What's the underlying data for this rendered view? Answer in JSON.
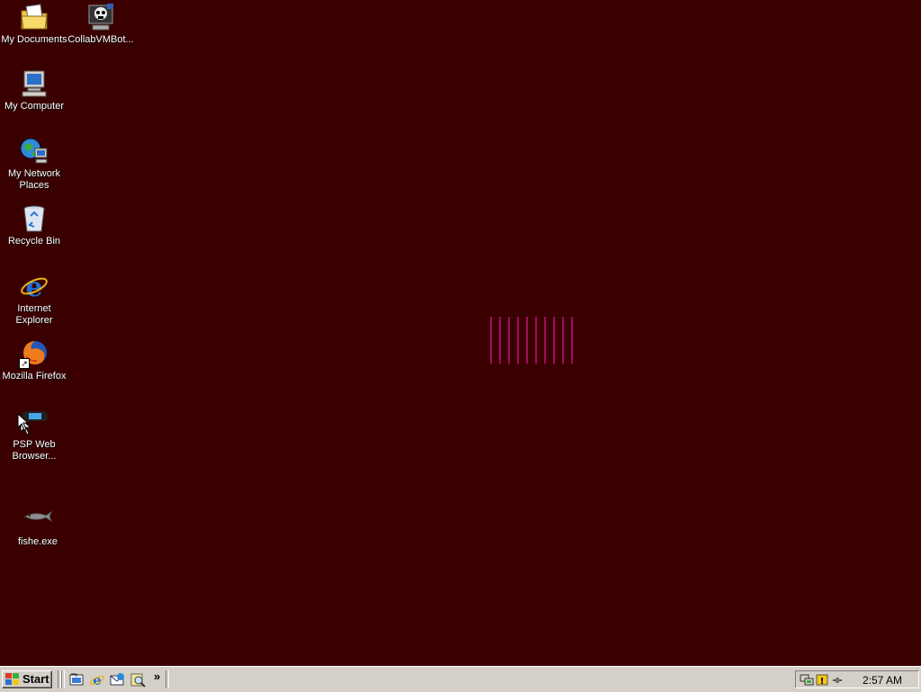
{
  "desktop": {
    "background": "#3a0000",
    "icons": [
      {
        "label": "My Documents"
      },
      {
        "label": "CollabVMBot..."
      },
      {
        "label": "My Computer"
      },
      {
        "label": "My Network Places"
      },
      {
        "label": "Recycle Bin"
      },
      {
        "label": "Internet Explorer"
      },
      {
        "label": "Mozilla Firefox"
      },
      {
        "label": "PSP Web Browser..."
      },
      {
        "label": "fishe.exe"
      }
    ],
    "center_graphic_color": "#c0108a"
  },
  "taskbar": {
    "start_label": "Start",
    "quick_launch": [
      "show-desktop-icon",
      "internet-explorer-icon",
      "outlook-express-icon",
      "search-icon"
    ],
    "chevron": "»",
    "clock": "2:57 AM"
  }
}
